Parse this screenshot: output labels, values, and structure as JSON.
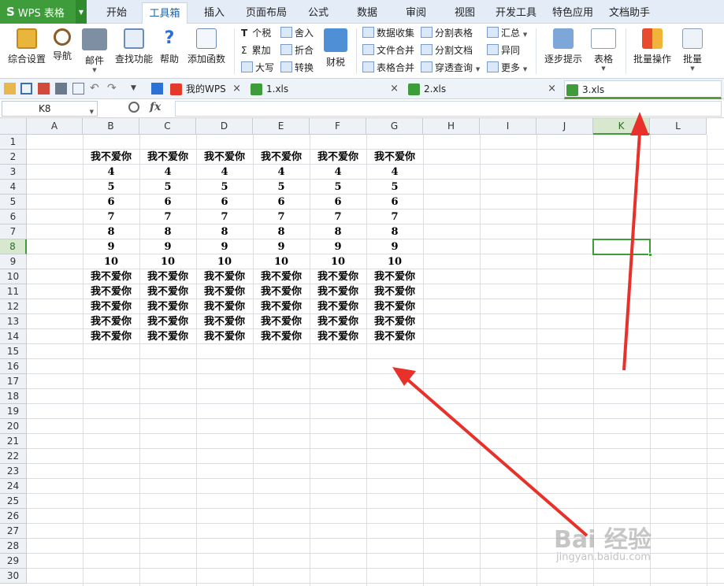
{
  "app": {
    "name": "WPS 表格",
    "logo": "S"
  },
  "menu_tabs": [
    "开始",
    "工具箱",
    "插入",
    "页面布局",
    "公式",
    "数据",
    "审阅",
    "视图",
    "开发工具",
    "特色应用",
    "文档助手"
  ],
  "active_menu_tab": "工具箱",
  "ribbon": {
    "big_buttons": [
      {
        "label": "综合设置",
        "icon": "settings-icon"
      },
      {
        "label": "导航",
        "icon": "ship-wheel-icon"
      },
      {
        "label": "邮件",
        "icon": "mail-icon"
      },
      {
        "label": "查找功能",
        "icon": "find-icon"
      },
      {
        "label": "帮助",
        "icon": "help-icon"
      },
      {
        "label": "添加函数",
        "icon": "add-function-icon"
      },
      {
        "label": "财税",
        "icon": "finance-tax-icon"
      },
      {
        "label": "逐步提示",
        "icon": "step-hint-icon"
      },
      {
        "label": "表格",
        "icon": "table-icon"
      },
      {
        "label": "批量操作",
        "icon": "batch-operation-icon"
      },
      {
        "label": "批量",
        "icon": "batch-icon"
      }
    ],
    "small_buttons": [
      {
        "label": "个税",
        "prefix": "T"
      },
      {
        "label": "舍入",
        "prefix": ""
      },
      {
        "label": "累加",
        "prefix": "Σ"
      },
      {
        "label": "折合",
        "prefix": ""
      },
      {
        "label": "大写",
        "prefix": ""
      },
      {
        "label": "转换",
        "prefix": ""
      },
      {
        "label": "数据收集",
        "prefix": ""
      },
      {
        "label": "分割表格",
        "prefix": ""
      },
      {
        "label": "汇总",
        "prefix": ""
      },
      {
        "label": "文件合并",
        "prefix": ""
      },
      {
        "label": "分割文档",
        "prefix": ""
      },
      {
        "label": "异同",
        "prefix": ""
      },
      {
        "label": "表格合并",
        "prefix": ""
      },
      {
        "label": "穿透查询",
        "prefix": ""
      },
      {
        "label": "更多",
        "prefix": ""
      }
    ]
  },
  "doc_tabs": [
    {
      "label": "我的WPS",
      "icon": "wps-icon"
    },
    {
      "label": "1.xls",
      "icon": "xls-icon"
    },
    {
      "label": "2.xls",
      "icon": "xls-icon"
    },
    {
      "label": "3.xls",
      "icon": "xls-icon"
    }
  ],
  "active_doc": "3.xls",
  "formula_bar": {
    "name_box": "K8",
    "fx": "fx",
    "value": ""
  },
  "columns": [
    "A",
    "B",
    "C",
    "D",
    "E",
    "F",
    "G",
    "H",
    "I",
    "J",
    "K",
    "L"
  ],
  "selected_column": "K",
  "rows": [
    "1",
    "2",
    "3",
    "4",
    "5",
    "6",
    "7",
    "8",
    "9",
    "10",
    "11",
    "12",
    "13",
    "14",
    "15",
    "16",
    "17",
    "18",
    "19",
    "20",
    "21",
    "22",
    "23",
    "24",
    "25",
    "26",
    "27",
    "28",
    "29",
    "30"
  ],
  "selected_row": "8",
  "sheet": {
    "B2:G2": "我不爱你",
    "row3": "4",
    "row4": "5",
    "row5": "6",
    "row6": "7",
    "row7": "8",
    "row8": "9",
    "row9": "10",
    "rows10_14": "我不爱你"
  },
  "watermark": {
    "text": "Bai 经验",
    "sub": "jingyan.baidu.com"
  },
  "colors": {
    "accent": "#3e9c3a",
    "arrow": "#e8312b"
  }
}
